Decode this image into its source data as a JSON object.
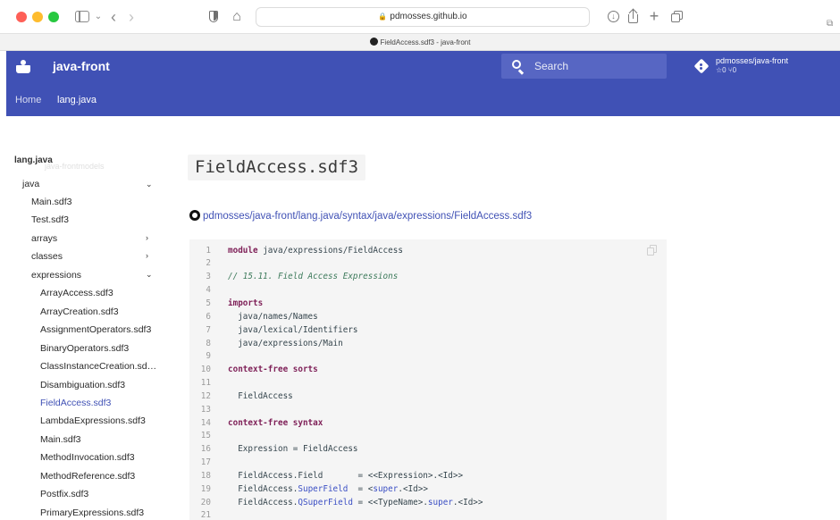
{
  "browser": {
    "url": "pdmosses.github.io",
    "tab_title": "FieldAccess.sdf3 - java-front"
  },
  "header": {
    "site_title": "java-front",
    "search_placeholder": "Search",
    "repo_name": "pdmosses/java-front",
    "repo_stats": "☆0  ⑂0",
    "nav_home": "Home",
    "nav_current": "lang.java"
  },
  "leftnav": {
    "title": "lang.java",
    "ghost": "java-frontmodels",
    "items": [
      {
        "label": "java",
        "chevron": "⌄"
      },
      {
        "label": "Main.sdf3"
      },
      {
        "label": "Test.sdf3"
      },
      {
        "label": "arrays",
        "chevron": "›"
      },
      {
        "label": "classes",
        "chevron": "›"
      },
      {
        "label": "expressions",
        "chevron": "⌄"
      },
      {
        "label": "ArrayAccess.sdf3"
      },
      {
        "label": "ArrayCreation.sdf3"
      },
      {
        "label": "AssignmentOperators.sdf3"
      },
      {
        "label": "BinaryOperators.sdf3"
      },
      {
        "label": "ClassInstanceCreation.sd…"
      },
      {
        "label": "Disambiguation.sdf3"
      },
      {
        "label": "FieldAccess.sdf3",
        "active": true
      },
      {
        "label": "LambdaExpressions.sdf3"
      },
      {
        "label": "Main.sdf3"
      },
      {
        "label": "MethodInvocation.sdf3"
      },
      {
        "label": "MethodReference.sdf3"
      },
      {
        "label": "Postfix.sdf3"
      },
      {
        "label": "PrimaryExpressions.sdf3"
      }
    ]
  },
  "main": {
    "heading": "FieldAccess.sdf3",
    "source_link": "pdmosses/java-front/lang.java/syntax/java/expressions/FieldAccess.sdf3",
    "code_lines": [
      {
        "n": "1",
        "t": "module java/expressions/FieldAccess"
      },
      {
        "n": "2",
        "t": ""
      },
      {
        "n": "3",
        "t": "// 15.11. Field Access Expressions"
      },
      {
        "n": "4",
        "t": ""
      },
      {
        "n": "5",
        "t": "imports"
      },
      {
        "n": "6",
        "t": "  java/names/Names"
      },
      {
        "n": "7",
        "t": "  java/lexical/Identifiers"
      },
      {
        "n": "8",
        "t": "  java/expressions/Main"
      },
      {
        "n": "9",
        "t": ""
      },
      {
        "n": "10",
        "t": "context-free sorts"
      },
      {
        "n": "11",
        "t": ""
      },
      {
        "n": "12",
        "t": "  FieldAccess"
      },
      {
        "n": "13",
        "t": ""
      },
      {
        "n": "14",
        "t": "context-free syntax"
      },
      {
        "n": "15",
        "t": ""
      },
      {
        "n": "16",
        "t": "  Expression = FieldAccess"
      },
      {
        "n": "17",
        "t": ""
      },
      {
        "n": "18",
        "t": "  FieldAccess.Field       = <<Expression>.<Id>>"
      },
      {
        "n": "19",
        "t": "  FieldAccess.SuperField  = <super.<Id>>"
      },
      {
        "n": "20",
        "t": "  FieldAccess.QSuperField = <<TypeName>.super.<Id>>"
      },
      {
        "n": "21",
        "t": ""
      }
    ]
  },
  "colors": {
    "header_bg": "#4051b5",
    "link": "#4051b5",
    "keyword": "#7e1f57",
    "comment": "#3d7a5b"
  }
}
